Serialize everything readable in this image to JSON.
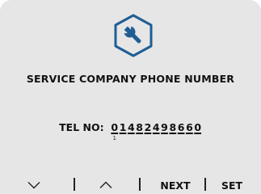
{
  "screen": {
    "title": "SERVICE COMPANY PHONE NUMBER",
    "tel_label": "TEL NO:",
    "digits": [
      "0",
      "1",
      "4",
      "8",
      "2",
      "4",
      "9",
      "8",
      "6",
      "6",
      "0"
    ],
    "cursor_mark": "1",
    "icon": "wrench-hexagon-icon"
  },
  "softkeys": {
    "down": "chevron-down-icon",
    "up": "chevron-up-icon",
    "next_label": "NEXT",
    "set_label": "SET"
  },
  "colors": {
    "background": "#e6e6e6",
    "accent": "#1f5e93",
    "text": "#111111"
  }
}
